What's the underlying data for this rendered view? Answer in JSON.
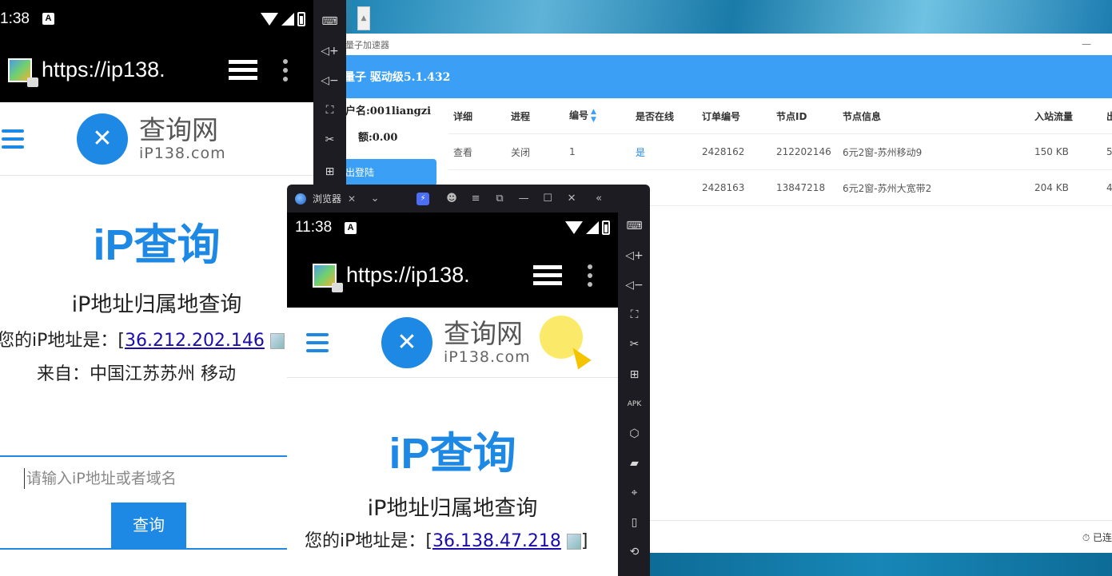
{
  "bg_app": {
    "title": "量子加速器",
    "header": "量子 驱动级5.1.432",
    "account": {
      "user_label": "户名:001liangzi",
      "balance_label": "额:0.00",
      "logout": "出登陆"
    },
    "columns": [
      "详细",
      "进程",
      "编号",
      "是否在线",
      "订单编号",
      "节点ID",
      "节点信息",
      "入站流量",
      "出"
    ],
    "rows": [
      {
        "detail": "查看",
        "process": "关闭",
        "num": "1",
        "online": "是",
        "order": "2428162",
        "node_id": "212202146",
        "node_info": "6元2窗-苏州移动9",
        "traffic": "150 KB",
        "out": "5"
      },
      {
        "detail": "",
        "process": "",
        "num": "",
        "online": "",
        "order": "2428163",
        "node_id": "13847218",
        "node_info": "6元2窗-苏州大宽带2",
        "traffic": "204 KB",
        "out": "4"
      }
    ],
    "footer_status": "⏱ 已连"
  },
  "emu1": {
    "time": "1:38",
    "url": "https://ip138.",
    "logo_cn": "查询网",
    "logo_en": "iP138.com",
    "title": "iP查询",
    "subtitle": "iP地址归属地查询",
    "ip_prefix": "您的iP地址是：[",
    "ip": "36.212.202.146",
    "from": "来自：中国江苏苏州 移动",
    "placeholder": "请输入iP地址或者域名",
    "query_btn": "查询"
  },
  "emu2": {
    "tab_label": "浏览器",
    "time": "11:38",
    "url": "https://ip138.",
    "logo_cn": "查询网",
    "logo_en": "iP138.com",
    "title": "iP查询",
    "subtitle": "iP地址归属地查询",
    "ip_prefix": "您的iP地址是：[",
    "ip": "36.138.47.218",
    "ip_suffix": "]"
  },
  "colors": {
    "accent": "#3a9ff5",
    "ip138_blue": "#1e88e5",
    "link": "#1a0dab"
  }
}
